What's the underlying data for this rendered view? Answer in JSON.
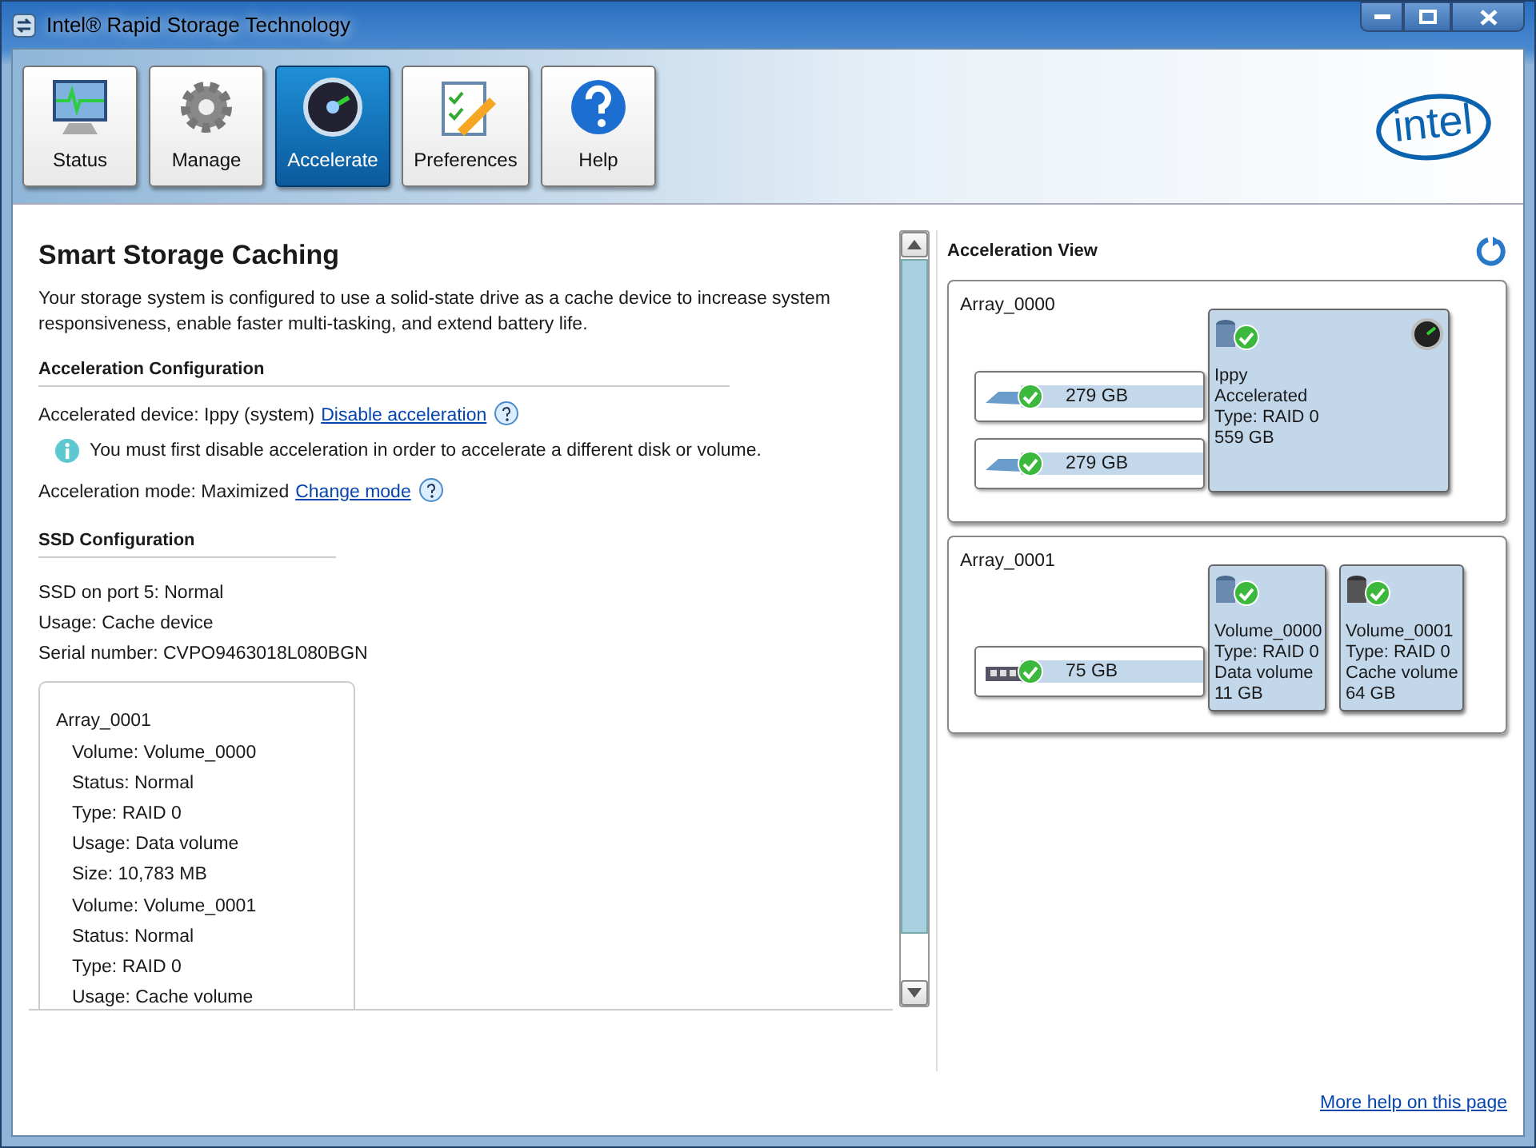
{
  "window": {
    "title": "Intel® Rapid Storage Technology"
  },
  "toolbar": {
    "tabs": [
      {
        "label": "Status",
        "kind": "monitor",
        "selected": false
      },
      {
        "label": "Manage",
        "kind": "gear",
        "selected": false
      },
      {
        "label": "Accelerate",
        "kind": "gauge",
        "selected": true
      },
      {
        "label": "Preferences",
        "kind": "clipboard",
        "selected": false
      },
      {
        "label": "Help",
        "kind": "help",
        "selected": false
      }
    ],
    "logo": "intel"
  },
  "main": {
    "heading": "Smart Storage Caching",
    "description": "Your storage system is configured to use a solid-state drive as a cache device to increase system responsiveness, enable faster multi-tasking, and extend battery life.",
    "acceleration_configuration": {
      "heading": "Acceleration Configuration",
      "device_label": "Accelerated device: Ippy (system)",
      "disable_link": "Disable acceleration",
      "info": "You must first disable acceleration in order to accelerate a different disk or volume.",
      "mode_label": "Acceleration mode: Maximized",
      "change_mode_link": "Change mode"
    },
    "ssd_configuration": {
      "heading": "SSD Configuration",
      "lines": [
        "SSD on port 5: Normal",
        "Usage: Cache device",
        "Serial number: CVPO9463018L080BGN"
      ]
    },
    "details": {
      "array": "Array_0001",
      "volumes": [
        {
          "lines": [
            "Volume: Volume_0000",
            "Status: Normal",
            "Type: RAID 0",
            "Usage: Data volume",
            "Size: 10,783 MB"
          ]
        },
        {
          "lines": [
            "Volume: Volume_0001",
            "Status: Normal",
            "Type: RAID 0",
            "Usage: Cache volume"
          ]
        }
      ]
    }
  },
  "acceleration_view": {
    "title": "Acceleration View",
    "arrays": [
      {
        "name": "Array_0000",
        "disks": [
          {
            "size": "279 GB",
            "kind": "hdd"
          },
          {
            "size": "279 GB",
            "kind": "hdd"
          }
        ],
        "volumes": [
          {
            "lines": [
              "Ippy",
              "Accelerated",
              "Type: RAID 0",
              "559 GB"
            ],
            "kind": "data",
            "accelerated": true
          }
        ]
      },
      {
        "name": "Array_0001",
        "disks": [
          {
            "size": "75 GB",
            "kind": "ssd"
          }
        ],
        "volumes": [
          {
            "lines": [
              "Volume_0000",
              "Type: RAID 0",
              "Data volume",
              "11 GB"
            ],
            "kind": "data",
            "accelerated": false
          },
          {
            "lines": [
              "Volume_0001",
              "Type: RAID 0",
              "Cache volume",
              "64 GB"
            ],
            "kind": "cache",
            "accelerated": false
          }
        ]
      }
    ]
  },
  "footer": {
    "help_link": "More help on this page"
  }
}
